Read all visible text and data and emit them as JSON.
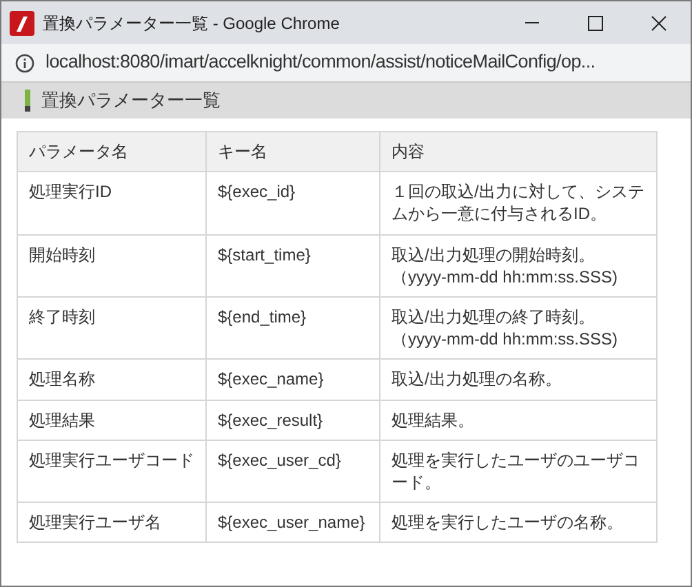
{
  "window": {
    "title": "置換パラメーター一覧 - Google Chrome"
  },
  "address_bar": {
    "url": "localhost:8080/imart/accelknight/common/assist/noticeMailConfig/op..."
  },
  "page_header": {
    "title": "置換パラメーター一覧"
  },
  "table": {
    "columns": [
      "パラメータ名",
      "キー名",
      "内容"
    ],
    "rows": [
      [
        "処理実行ID",
        "${exec_id}",
        "１回の取込/出力に対して、システムから一意に付与されるID。"
      ],
      [
        "開始時刻",
        "${start_time}",
        "取込/出力処理の開始時刻。（yyyy-mm-dd hh:mm:ss.SSS)"
      ],
      [
        "終了時刻",
        "${end_time}",
        "取込/出力処理の終了時刻。（yyyy-mm-dd hh:mm:ss.SSS)"
      ],
      [
        "処理名称",
        "${exec_name}",
        "取込/出力処理の名称。"
      ],
      [
        "処理結果",
        "${exec_result}",
        "処理結果。"
      ],
      [
        "処理実行ユーザコード",
        "${exec_user_cd}",
        "処理を実行したユーザのユーザコード。"
      ],
      [
        "処理実行ユーザ名",
        "${exec_user_name}",
        "処理を実行したユーザの名称。"
      ]
    ]
  }
}
